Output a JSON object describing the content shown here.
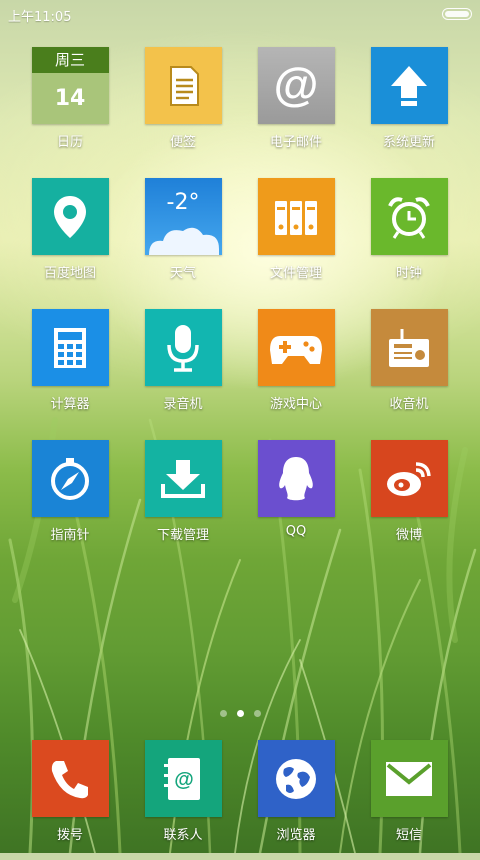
{
  "status_bar": {
    "time": "上午11:05"
  },
  "calendar": {
    "weekday": "周三",
    "day": "14"
  },
  "weather": {
    "temperature": "-2°"
  },
  "apps": [
    {
      "label": "日历",
      "icon": "calendar-icon",
      "color": "#8fb35c"
    },
    {
      "label": "便签",
      "icon": "notes-icon",
      "color": "#f3c24b"
    },
    {
      "label": "电子邮件",
      "icon": "email-at-icon",
      "color": "#a8a8a8"
    },
    {
      "label": "系统更新",
      "icon": "update-arrow-icon",
      "color": "#1a8fd8"
    },
    {
      "label": "百度地图",
      "icon": "map-pin-icon",
      "color": "#15b0a0"
    },
    {
      "label": "天气",
      "icon": "weather-cloud-icon",
      "color": "#2b8fe0"
    },
    {
      "label": "文件管理",
      "icon": "binders-icon",
      "color": "#ef9b1b"
    },
    {
      "label": "时钟",
      "icon": "alarm-clock-icon",
      "color": "#6ab82c"
    },
    {
      "label": "计算器",
      "icon": "calculator-icon",
      "color": "#1b8fe6"
    },
    {
      "label": "录音机",
      "icon": "microphone-icon",
      "color": "#12b6b0"
    },
    {
      "label": "游戏中心",
      "icon": "gamepad-icon",
      "color": "#f08a18"
    },
    {
      "label": "收音机",
      "icon": "radio-icon",
      "color": "#c58a3c"
    },
    {
      "label": "指南针",
      "icon": "compass-icon",
      "color": "#1a84d6"
    },
    {
      "label": "下载管理",
      "icon": "download-icon",
      "color": "#14b3a2"
    },
    {
      "label": "QQ",
      "icon": "qq-penguin-icon",
      "color": "#6b4fcf"
    },
    {
      "label": "微博",
      "icon": "weibo-icon",
      "color": "#d7461e"
    }
  ],
  "dock": [
    {
      "label": "拨号",
      "icon": "phone-handset-icon",
      "color": "#db4a1f"
    },
    {
      "label": "联系人",
      "icon": "contacts-book-icon",
      "color": "#14a57c"
    },
    {
      "label": "浏览器",
      "icon": "globe-icon",
      "color": "#2f62c8"
    },
    {
      "label": "短信",
      "icon": "envelope-icon",
      "color": "#5aa02c"
    }
  ],
  "pages": {
    "count": 3,
    "active": 2
  }
}
